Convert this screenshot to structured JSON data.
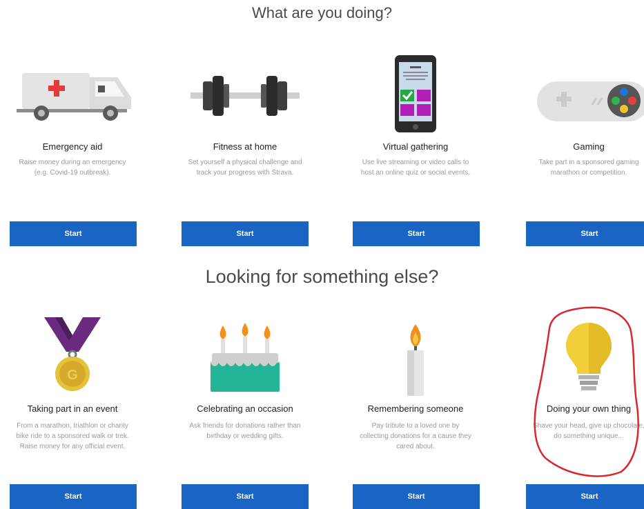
{
  "sections": [
    {
      "title": "What are you doing?",
      "cards": [
        {
          "title": "Emergency aid",
          "description": "Raise money during an emergency (e.g. Covid-19 outbreak).",
          "button": "Start",
          "icon": "ambulance-icon"
        },
        {
          "title": "Fitness at home",
          "description": "Set yourself a physical challenge and track your progress with Strava.",
          "button": "Start",
          "icon": "dumbbell-icon"
        },
        {
          "title": "Virtual gathering",
          "description": "Use live streaming or video calls to host an online quiz or social events.",
          "button": "Start",
          "icon": "smartphone-icon"
        },
        {
          "title": "Gaming",
          "description": "Take part in a sponsored gaming marathon or competition.",
          "button": "Start",
          "icon": "gamepad-icon"
        }
      ]
    },
    {
      "title": "Looking for something else?",
      "cards": [
        {
          "title": "Taking part in an event",
          "description": "From a marathon, triathlon or charity bike ride to a sponsored walk or trek. Raise money for any official event.",
          "button": "Start",
          "icon": "medal-icon"
        },
        {
          "title": "Celebrating an occasion",
          "description": "Ask friends for donations rather than birthday or wedding gifts.",
          "button": "Start",
          "icon": "birthday-cake-icon"
        },
        {
          "title": "Remembering someone",
          "description": "Pay tribute to a loved one by collecting donations for a cause they cared about.",
          "button": "Start",
          "icon": "candle-icon"
        },
        {
          "title": "Doing your own thing",
          "description": "Shave your head, give up chocolate, do something unique...",
          "button": "Start",
          "icon": "lightbulb-icon"
        }
      ]
    }
  ],
  "colors": {
    "button": "#1a64c4",
    "annotation": "#d9262c"
  }
}
